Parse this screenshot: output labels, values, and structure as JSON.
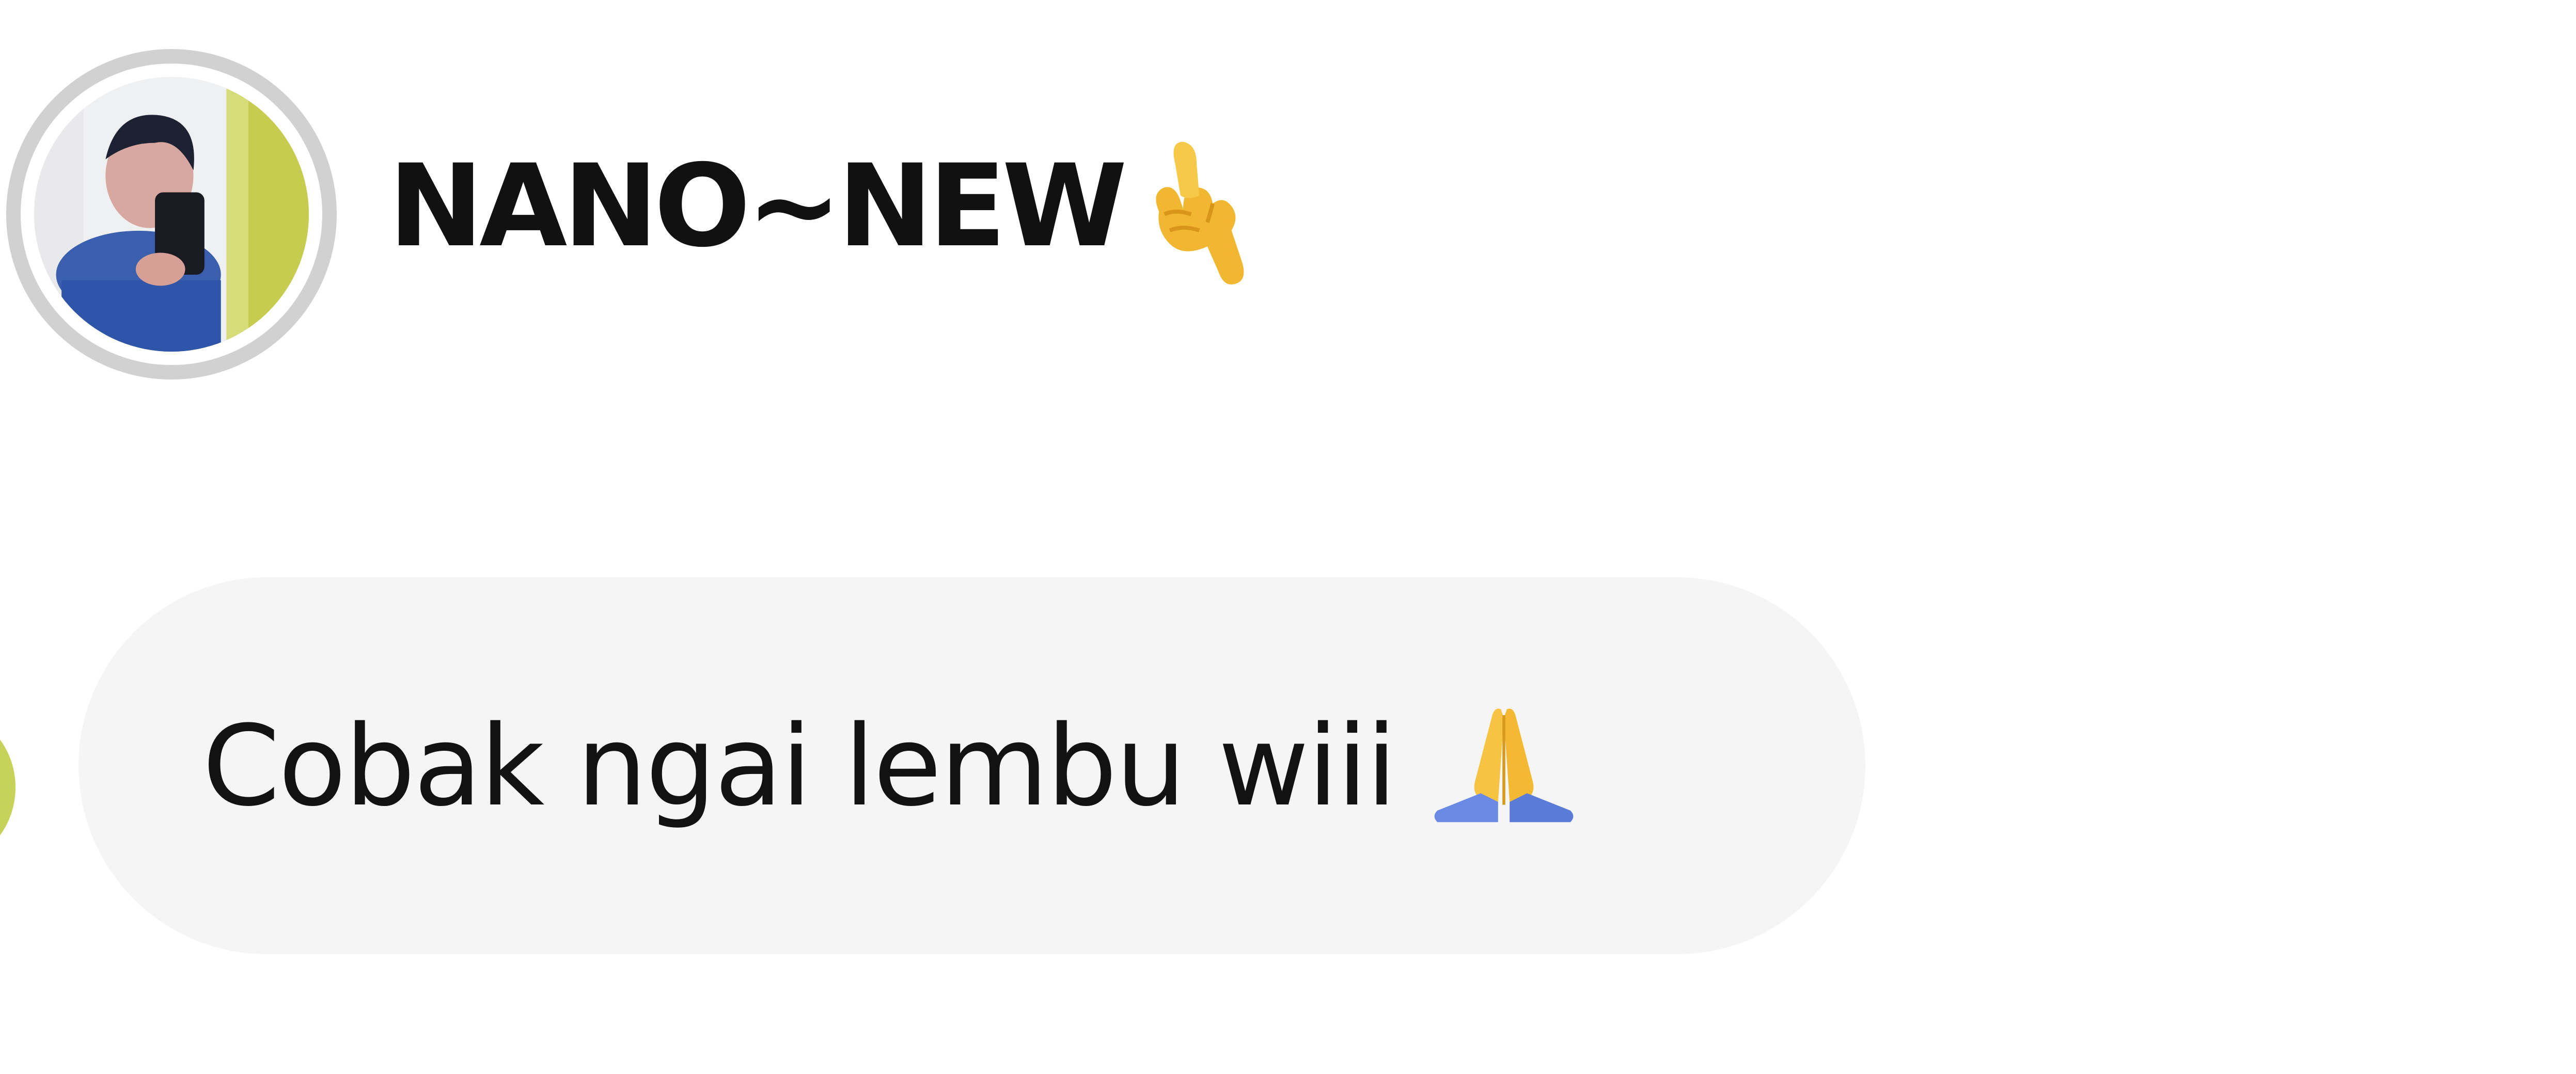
{
  "sender": {
    "name": "NANO~NEW",
    "name_emoji": "call-me-hand-emoji"
  },
  "message": {
    "text": "Cobak ngai lembu wiii",
    "emoji": "folded-hands-emoji"
  },
  "colors": {
    "avatar_ring": "#d1d1d1",
    "bubble_background": "#f5f5f5",
    "text": "#121212",
    "partial_avatar": "#c7d25a"
  }
}
